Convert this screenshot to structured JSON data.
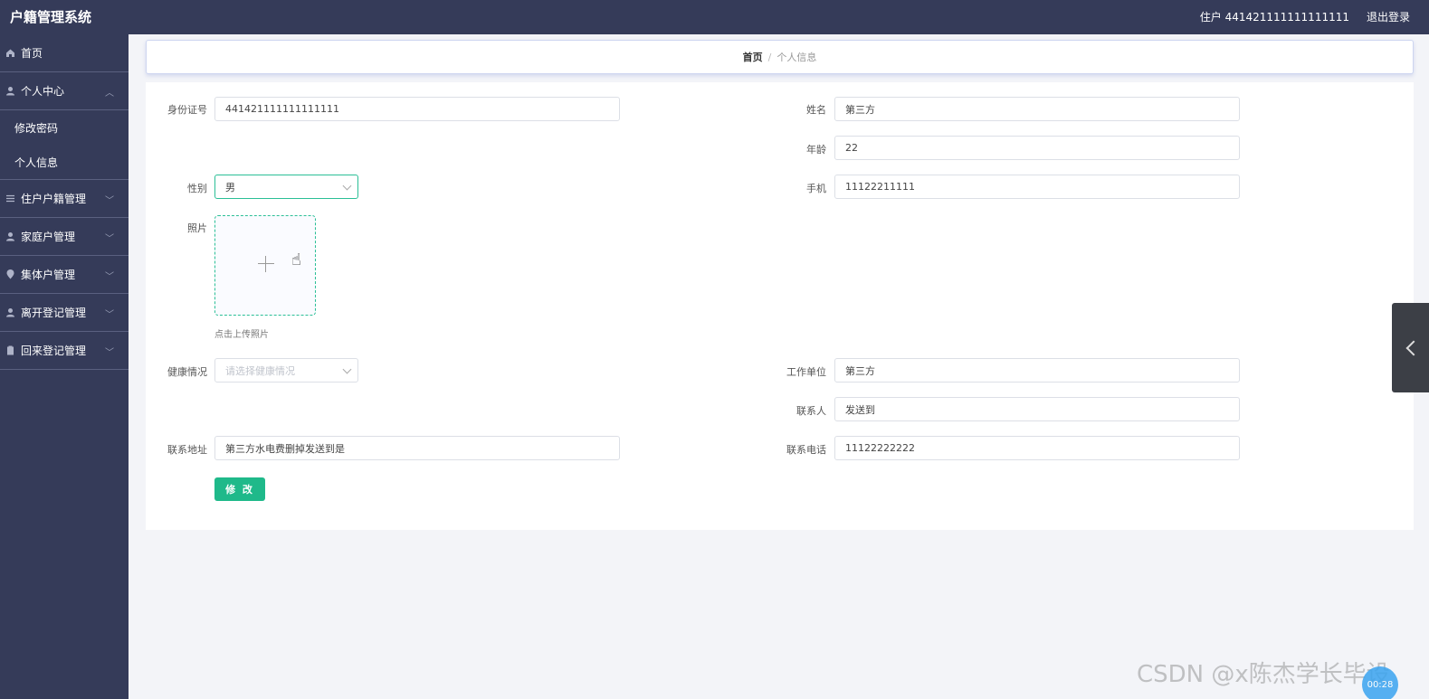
{
  "header": {
    "app_title": "户籍管理系统",
    "user_label": "住户 441421111111111111",
    "logout": "退出登录"
  },
  "sidebar": {
    "items": [
      {
        "label": "首页",
        "icon": "home-icon"
      },
      {
        "label": "个人中心",
        "icon": "user-icon",
        "expanded": true,
        "children": [
          {
            "label": "修改密码"
          },
          {
            "label": "个人信息"
          }
        ]
      },
      {
        "label": "住户户籍管理",
        "icon": "sliders-icon"
      },
      {
        "label": "家庭户管理",
        "icon": "user-icon"
      },
      {
        "label": "集体户管理",
        "icon": "location-icon"
      },
      {
        "label": "离开登记管理",
        "icon": "user-icon"
      },
      {
        "label": "回来登记管理",
        "icon": "clipboard-icon"
      }
    ]
  },
  "breadcrumb": {
    "home": "首页",
    "separator": "/",
    "current": "个人信息"
  },
  "form": {
    "id_card": {
      "label": "身份证号",
      "value": "441421111111111111"
    },
    "name": {
      "label": "姓名",
      "value": "第三方"
    },
    "age": {
      "label": "年龄",
      "value": "22"
    },
    "gender": {
      "label": "性别",
      "value": "男"
    },
    "phone": {
      "label": "手机",
      "value": "11122211111"
    },
    "photo": {
      "label": "照片",
      "tip": "点击上传照片"
    },
    "health": {
      "label": "健康情况",
      "placeholder": "请选择健康情况"
    },
    "work_unit": {
      "label": "工作单位",
      "value": "第三方"
    },
    "contact_person": {
      "label": "联系人",
      "value": "发送到"
    },
    "address": {
      "label": "联系地址",
      "value": "第三方水电费删掉发送到是"
    },
    "contact_phone": {
      "label": "联系电话",
      "value": "11122222222"
    },
    "submit_label": "修 改"
  },
  "overlay": {
    "watermark": "CSDN @x陈杰学长毕设",
    "time_badge": "00:28"
  },
  "colors": {
    "sidebar_bg": "#353b59",
    "accent_green": "#1fb98a",
    "page_bg": "#f3f4f8"
  }
}
